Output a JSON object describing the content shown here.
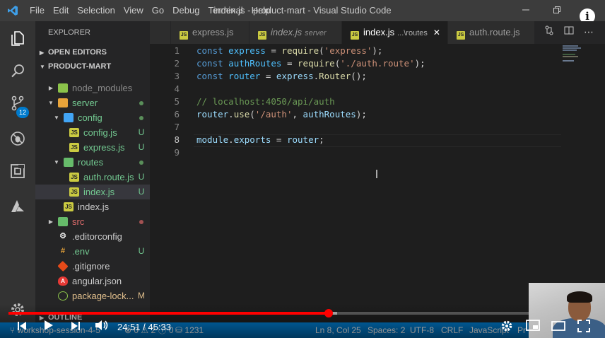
{
  "window": {
    "title": "index.js - product-mart - Visual Studio Code",
    "menu": [
      "File",
      "Edit",
      "Selection",
      "View",
      "Go",
      "Debug",
      "Terminal",
      "Help"
    ],
    "info_label": "i"
  },
  "activity_bar": {
    "icons": [
      "explorer-icon",
      "search-icon",
      "source-control-icon",
      "debug-icon",
      "extensions-icon",
      "azure-icon",
      "settings-gear-icon"
    ],
    "scm_badge": "12"
  },
  "sidebar": {
    "title": "EXPLORER",
    "open_editors_label": "OPEN EDITORS",
    "project_label": "PRODUCT-MART",
    "outline_label": "OUTLINE",
    "tree": [
      {
        "label": "node_modules",
        "kind": "folder",
        "status": ""
      },
      {
        "label": "server",
        "kind": "folder",
        "status": ""
      },
      {
        "label": "config",
        "kind": "folder",
        "status": ""
      },
      {
        "label": "config.js",
        "kind": "js",
        "status": "U"
      },
      {
        "label": "express.js",
        "kind": "js",
        "status": "U"
      },
      {
        "label": "routes",
        "kind": "folder",
        "status": ""
      },
      {
        "label": "auth.route.js",
        "kind": "js",
        "status": "U"
      },
      {
        "label": "index.js",
        "kind": "js",
        "status": "U"
      },
      {
        "label": "index.js",
        "kind": "js",
        "status": ""
      },
      {
        "label": "src",
        "kind": "folder",
        "status": ""
      },
      {
        "label": ".editorconfig",
        "kind": "config",
        "status": ""
      },
      {
        "label": ".env",
        "kind": "env",
        "status": "U"
      },
      {
        "label": ".gitignore",
        "kind": "git",
        "status": ""
      },
      {
        "label": "angular.json",
        "kind": "angular",
        "status": ""
      },
      {
        "label": "package-lock...",
        "kind": "json",
        "status": "M"
      }
    ]
  },
  "tabs": [
    {
      "label": "express.js",
      "desc": ""
    },
    {
      "label": "index.js",
      "desc": "server"
    },
    {
      "label": "index.js",
      "desc": "...\\routes"
    },
    {
      "label": "auth.route.js",
      "desc": ""
    }
  ],
  "editor": {
    "line_numbers": [
      "1",
      "2",
      "3",
      "4",
      "5",
      "6",
      "7",
      "8",
      "9"
    ],
    "code": {
      "l1": {
        "t1": "const",
        "t2": "express",
        "t3": "=",
        "t4": "require",
        "t5": "(",
        "t6": "'express'",
        "t7": ");"
      },
      "l2": {
        "t1": "const",
        "t2": "authRoutes",
        "t3": "=",
        "t4": "require",
        "t5": "(",
        "t6": "'./auth.route'",
        "t7": ");"
      },
      "l3": {
        "t1": "const",
        "t2": "router",
        "t3": "=",
        "t4": "express",
        "t5": ".",
        "t6": "Router",
        "t7": "();"
      },
      "l5": {
        "t1": "// localhost:4050/api/auth"
      },
      "l6": {
        "t1": "router",
        "t2": ".",
        "t3": "use",
        "t4": "(",
        "t5": "'/auth'",
        "t6": ", ",
        "t7": "authRoutes",
        "t8": ");"
      },
      "l8": {
        "t1": "module",
        "t2": ".",
        "t3": "exports",
        "t4": "=",
        "t5": "router",
        "t6": ";"
      }
    }
  },
  "status_bar": {
    "branch": "workshop-session-4-5",
    "errors": "0",
    "warnings": "2",
    "info": "0",
    "db": "1231",
    "position": "Ln 8, Col 25",
    "spaces": "Spaces: 2",
    "encoding": "UTF-8",
    "eol": "CRLF",
    "language": "JavaScript",
    "prettier": "Pr"
  },
  "video": {
    "current_time": "24:51",
    "separator": "/",
    "duration": "45:33",
    "progress_fraction": 0.5456,
    "buffered_fraction": 0.56
  }
}
